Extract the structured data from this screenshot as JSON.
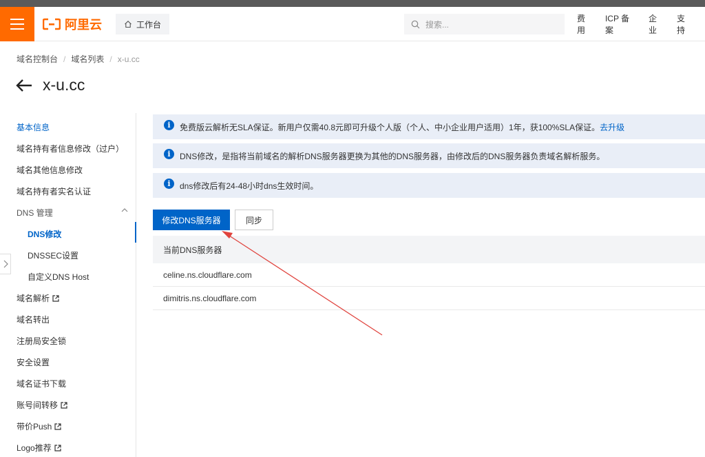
{
  "header": {
    "logo_text": "阿里云",
    "workbench_label": "工作台",
    "search_placeholder": "搜索...",
    "links": [
      "费用",
      "ICP 备案",
      "企业",
      "支持"
    ]
  },
  "breadcrumb": [
    "域名控制台",
    "域名列表",
    "x-u.cc"
  ],
  "page_title": "x-u.cc",
  "sidebar": {
    "items": [
      {
        "label": "基本信息"
      },
      {
        "label": "域名持有者信息修改（过户）"
      },
      {
        "label": "域名其他信息修改"
      },
      {
        "label": "域名持有者实名认证"
      },
      {
        "label": "DNS 管理"
      },
      {
        "label": "DNS修改"
      },
      {
        "label": "DNSSEC设置"
      },
      {
        "label": "自定义DNS Host"
      },
      {
        "label": "域名解析"
      },
      {
        "label": "域名转出"
      },
      {
        "label": "注册局安全锁"
      },
      {
        "label": "安全设置"
      },
      {
        "label": "域名证书下载"
      },
      {
        "label": "账号间转移"
      },
      {
        "label": "带价Push"
      },
      {
        "label": "Logo推荐"
      }
    ]
  },
  "notices": [
    {
      "text": "免费版云解析无SLA保证。新用户仅需40.8元即可升级个人版（个人、中小企业用户适用）1年，获100%SLA保证。",
      "link": "去升级"
    },
    {
      "text": "DNS修改，是指将当前域名的解析DNS服务器更换为其他的DNS服务器，由修改后的DNS服务器负责域名解析服务。"
    },
    {
      "text": "dns修改后有24-48小时dns生效时间。"
    }
  ],
  "buttons": {
    "modify_dns": "修改DNS服务器",
    "sync": "同步"
  },
  "dns_table": {
    "header": "当前DNS服务器",
    "rows": [
      "celine.ns.cloudflare.com",
      "dimitris.ns.cloudflare.com"
    ]
  },
  "colors": {
    "brand_orange": "#ff6a00",
    "primary_blue": "#0064c8",
    "annotation_red": "#e0443e"
  }
}
